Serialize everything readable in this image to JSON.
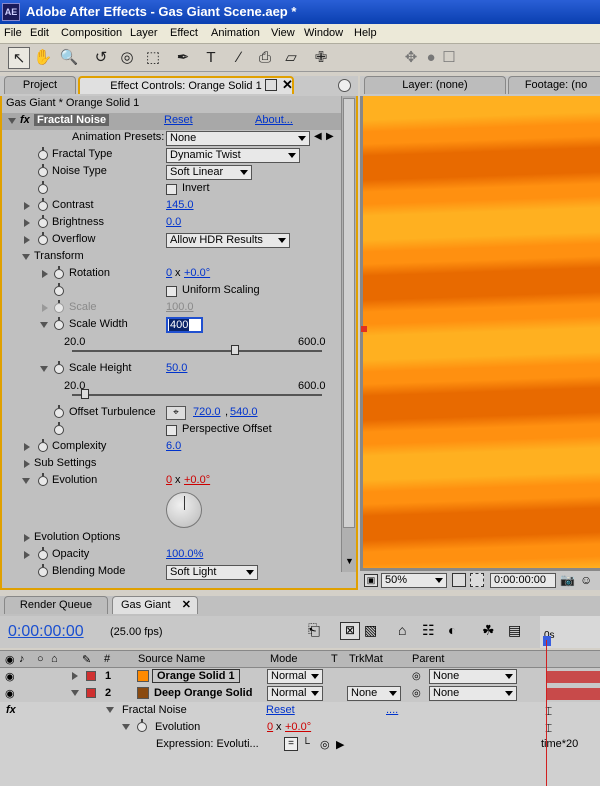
{
  "app": {
    "logo": "AE",
    "title": "Adobe After Effects - Gas Giant Scene.aep *"
  },
  "menu": [
    "File",
    "Edit",
    "Composition",
    "Layer",
    "Effect",
    "Animation",
    "View",
    "Window",
    "Help"
  ],
  "tools": [
    "selection-tool",
    "hand-tool",
    "zoom-tool",
    "rotation-tool",
    "orbit-camera-tool",
    "pan-behind-tool",
    "pen-tool",
    "type-tool",
    "brush-tool",
    "clone-stamp-tool",
    "eraser-tool",
    "puppet-pin-tool"
  ],
  "tabs_left": {
    "project": "Project",
    "effect_controls": "Effect Controls: Orange Solid 1"
  },
  "tabs_right": {
    "layer": "Layer: (none)",
    "footage": "Footage: (no"
  },
  "fx_panel": {
    "header": "Gas Giant * Orange Solid 1",
    "effect_name": "Fractal Noise",
    "reset": "Reset",
    "about": "About...",
    "presets_label": "Animation Presets:",
    "presets_value": "None",
    "fractal_type_label": "Fractal Type",
    "fractal_type_value": "Dynamic Twist",
    "noise_type_label": "Noise Type",
    "noise_type_value": "Soft Linear",
    "invert_label": "Invert",
    "contrast_label": "Contrast",
    "contrast_value": "145.0",
    "brightness_label": "Brightness",
    "brightness_value": "0.0",
    "overflow_label": "Overflow",
    "overflow_value": "Allow HDR Results",
    "transform_label": "Transform",
    "rotation_label": "Rotation",
    "rotation_rev": "0",
    "rotation_x": "x",
    "rotation_deg": "+0.0°",
    "uniform_label": "Uniform Scaling",
    "scale_label": "Scale",
    "scale_value": "100.0",
    "scale_width_label": "Scale Width",
    "scale_width_value": "400",
    "sw_min": "20.0",
    "sw_max": "600.0",
    "sw_level": 0.65,
    "scale_height_label": "Scale Height",
    "scale_height_value": "50.0",
    "sh_min": "20.0",
    "sh_max": "600.0",
    "sh_level": 0.05,
    "offset_label": "Offset Turbulence",
    "offset_x": "720.0",
    "offset_sep": ",",
    "offset_y": "540.0",
    "perspective_label": "Perspective Offset",
    "complexity_label": "Complexity",
    "complexity_value": "6.0",
    "sub_settings_label": "Sub Settings",
    "evolution_label": "Evolution",
    "evolution_rev": "0",
    "evolution_x": "x",
    "evolution_deg": "+0.0°",
    "evolution_options_label": "Evolution Options",
    "opacity_label": "Opacity",
    "opacity_value": "100.0%",
    "blending_label": "Blending Mode",
    "blending_value": "Soft Light"
  },
  "viewer": {
    "zoom": "50%",
    "timecode": "0:00:00:00",
    "colors": {
      "light": "#ffb020",
      "mid": "#ff9010",
      "dark": "#e86a00"
    }
  },
  "timeline": {
    "tab_render": "Render Queue",
    "tab_comp": "Gas Giant",
    "timecode": "0:00:00:00",
    "fps": "(25.00 fps)",
    "ruler_label": "0s",
    "cols": {
      "hash": "#",
      "source": "Source Name",
      "mode": "Mode",
      "t": "T",
      "trkmat": "TrkMat",
      "parent": "Parent"
    },
    "layers": [
      {
        "num": "1",
        "name": "Orange Solid 1",
        "mode": "Normal",
        "trkmat": "",
        "parent": "None",
        "color": "#ff8a00"
      },
      {
        "num": "2",
        "name": "Deep Orange Solid",
        "mode": "Normal",
        "trkmat": "None",
        "parent": "None",
        "color": "#8a4a10"
      }
    ],
    "fx_row": {
      "effect_label": "Fractal Noise",
      "reset": "Reset",
      "dots": "....",
      "evolution_label": "Evolution",
      "evo_rev": "0",
      "evo_x": "x",
      "evo_deg": "+0.0°",
      "expression_label": "Expression: Evoluti...",
      "expression_text": "time*20"
    }
  }
}
